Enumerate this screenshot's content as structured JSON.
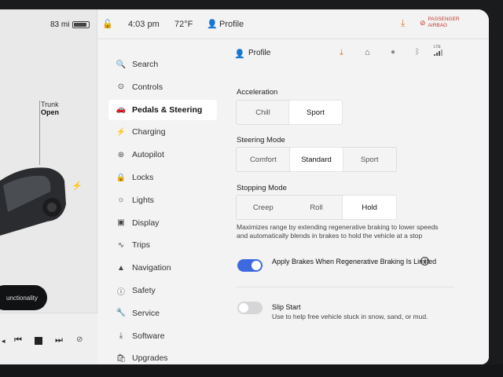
{
  "left_panel": {
    "range": "83 mi",
    "trunk_label": "Trunk",
    "trunk_status": "Open",
    "pill_text": "unctionality"
  },
  "status_bar": {
    "time": "4:03 pm",
    "temperature": "72°F",
    "profile_label": "Profile",
    "passenger_airbag_line1": "PASSENGER",
    "passenger_airbag_line2": "AIRBAG"
  },
  "sidebar": {
    "items": [
      {
        "label": "Search",
        "icon": "search-icon"
      },
      {
        "label": "Controls",
        "icon": "toggle-icon"
      },
      {
        "label": "Pedals & Steering",
        "icon": "car-icon"
      },
      {
        "label": "Charging",
        "icon": "bolt-icon"
      },
      {
        "label": "Autopilot",
        "icon": "steering-wheel-icon"
      },
      {
        "label": "Locks",
        "icon": "lock-icon"
      },
      {
        "label": "Lights",
        "icon": "sun-icon"
      },
      {
        "label": "Display",
        "icon": "display-icon"
      },
      {
        "label": "Trips",
        "icon": "trips-icon"
      },
      {
        "label": "Navigation",
        "icon": "navigation-icon"
      },
      {
        "label": "Safety",
        "icon": "safety-icon"
      },
      {
        "label": "Service",
        "icon": "wrench-icon"
      },
      {
        "label": "Software",
        "icon": "download-icon"
      },
      {
        "label": "Upgrades",
        "icon": "bag-icon"
      }
    ],
    "active": "Pedals & Steering"
  },
  "main": {
    "profile_label": "Profile",
    "lte_label": "LTE",
    "acceleration": {
      "title": "Acceleration",
      "options": [
        "Chill",
        "Sport"
      ],
      "selected": "Sport"
    },
    "steering_mode": {
      "title": "Steering Mode",
      "options": [
        "Comfort",
        "Standard",
        "Sport"
      ],
      "selected": "Standard"
    },
    "stopping_mode": {
      "title": "Stopping Mode",
      "options": [
        "Creep",
        "Roll",
        "Hold"
      ],
      "selected": "Hold",
      "description": "Maximizes range by extending regenerative braking to lower speeds and automatically blends in brakes to hold the vehicle at a stop"
    },
    "apply_brakes": {
      "label": "Apply Brakes When Regenerative Braking Is Limited",
      "enabled": true
    },
    "slip_start": {
      "label": "Slip Start",
      "description": "Use to help free vehicle stuck in snow, sand, or mud.",
      "enabled": false
    }
  },
  "colors": {
    "toggle_on": "#3e6ae1",
    "toggle_off": "#d6d6d8",
    "download_accent": "#e07a2c",
    "airbag_red": "#c23a2b"
  }
}
